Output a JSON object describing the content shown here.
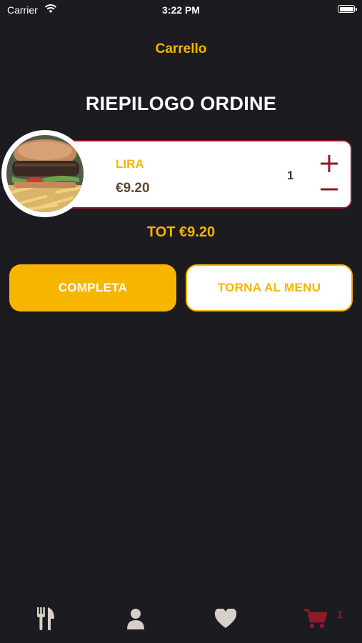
{
  "statusbar": {
    "carrier": "Carrier",
    "time": "3:22 PM"
  },
  "nav": {
    "title": "Carrello"
  },
  "page": {
    "title": "RIEPILOGO ORDINE"
  },
  "cart": {
    "items": [
      {
        "name": "LIRA",
        "price": "€9.20",
        "quantity": "1"
      }
    ],
    "total": "TOT €9.20"
  },
  "actions": {
    "complete_label": "COMPLETA",
    "back_label": "TORNA AL MENU"
  },
  "tabbar": {
    "tabs": [
      {
        "icon": "fork-knife-icon"
      },
      {
        "icon": "user-icon"
      },
      {
        "icon": "heart-icon"
      },
      {
        "icon": "cart-icon"
      }
    ],
    "cart_badge": "1"
  },
  "colors": {
    "accent": "#f7b500",
    "brand": "#8e1a2a",
    "background": "#1c1b1f",
    "tab_inactive": "#d6d0c6"
  }
}
